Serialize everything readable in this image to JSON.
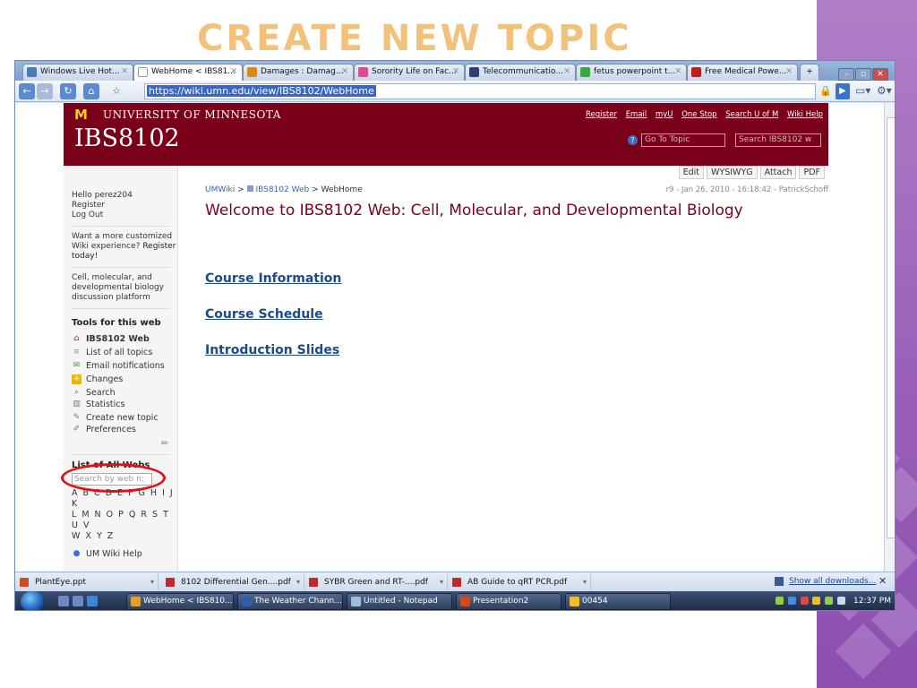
{
  "slide": {
    "title": "CREATE NEW TOPIC"
  },
  "browser": {
    "tabs": [
      {
        "label": "Windows Live Hot..."
      },
      {
        "label": "WebHome < IBS81..."
      },
      {
        "label": "Damages : Damag..."
      },
      {
        "label": "Sorority Life on Fac..."
      },
      {
        "label": "Telecommunicatio..."
      },
      {
        "label": "fetus powerpoint t..."
      },
      {
        "label": "Free Medical Powe..."
      }
    ],
    "url": "https://wiki.umn.edu/view/IBS8102/WebHome"
  },
  "site": {
    "university": "UNIVERSITY OF MINNESOTA",
    "title": "IBS8102",
    "top_links": [
      "Register",
      "Email",
      "myU",
      "One Stop",
      "Search U of M",
      "Wiki Help"
    ],
    "goto_placeholder": "Go To Topic",
    "search_placeholder": "Search IBS8102 w"
  },
  "sidebar": {
    "hello": "Hello perez204",
    "register": "Register",
    "logout": "Log Out",
    "want_more": "Want a more customized Wiki experience?",
    "register_today": "Register today!",
    "description": "Cell, molecular, and developmental biology discussion platform",
    "tools_heading": "Tools for this web",
    "tools": [
      {
        "label": "IBS8102 Web"
      },
      {
        "label": "List of all topics"
      },
      {
        "label": "Email notifications"
      },
      {
        "label": "Changes"
      },
      {
        "label": "Search"
      },
      {
        "label": "Statistics"
      },
      {
        "label": "Create new topic"
      },
      {
        "label": "Preferences"
      }
    ],
    "webs_heading": "List of All Webs",
    "webs_search_placeholder": "Search by web n:",
    "alpha_rows": [
      "A B C D E F G H I J K",
      "L M N O P Q R S T U V",
      "W X Y Z"
    ],
    "footer_link": "UM Wiki Help"
  },
  "main": {
    "actions": [
      "Edit",
      "WYSIWYG",
      "Attach",
      "PDF"
    ],
    "breadcrumb": {
      "root": "UMWiki",
      "sep": ">",
      "web": "IBS8102 Web",
      "current": "WebHome"
    },
    "revision": "r9 - Jan 26, 2010 - 16:18:42 - PatrickSchoff",
    "heading": "Welcome to IBS8102 Web: Cell, Molecular, and Developmental Biology",
    "links": [
      {
        "label": "Course Information"
      },
      {
        "label": "Course Schedule"
      },
      {
        "label": "Introduction Slides"
      }
    ]
  },
  "downloads": {
    "items": [
      {
        "label": "PlantEye.ppt"
      },
      {
        "label": "8102 Differential Gen....pdf"
      },
      {
        "label": "SYBR Green and RT-....pdf"
      },
      {
        "label": "AB Guide to qRT PCR.pdf"
      }
    ],
    "show_all": "Show all downloads...",
    "close": "✕"
  },
  "taskbar": {
    "tasks": [
      {
        "label": "WebHome < IBS810..."
      },
      {
        "label": "The Weather Chann..."
      },
      {
        "label": "Untitled - Notepad"
      },
      {
        "label": "Presentation2"
      },
      {
        "label": "00454"
      }
    ],
    "time": "12:37 PM"
  },
  "colors": {
    "accent_title": "#f3c27a",
    "umn_maroon": "#7a0019",
    "umn_gold": "#ffcc33",
    "annotation_red": "#e3101a",
    "link_blue": "#1c4b8c"
  }
}
